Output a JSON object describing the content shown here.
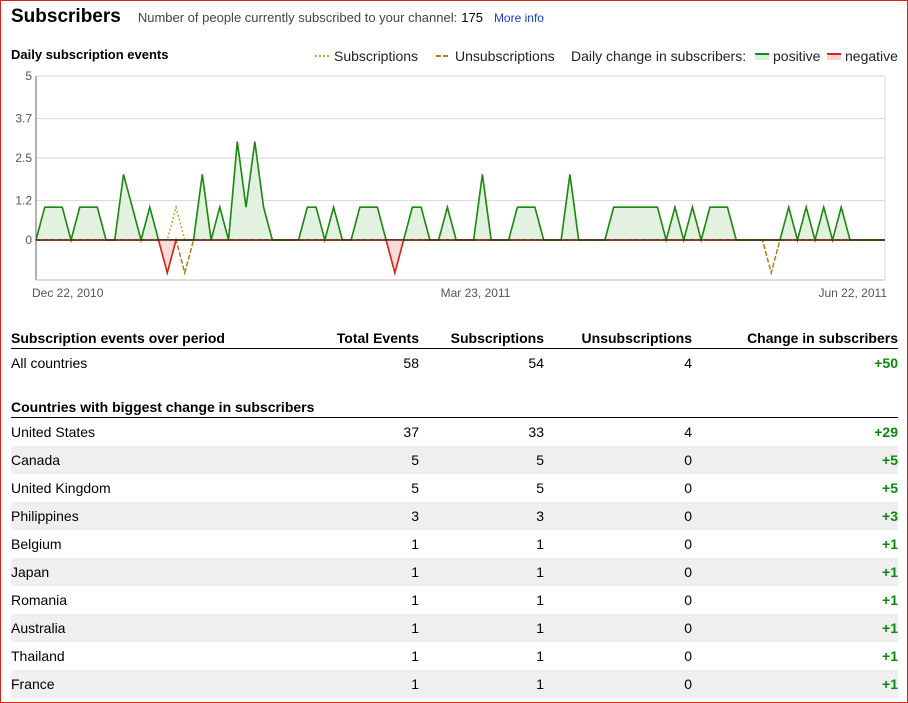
{
  "header": {
    "title": "Subscribers",
    "subtitle": "Number of people currently subscribed to your channel:",
    "count": "175",
    "more_info": "More info"
  },
  "chart_title": "Daily subscription events",
  "legend": {
    "subscriptions": "Subscriptions",
    "unsubscriptions": "Unsubscriptions",
    "daily_change": "Daily change in subscribers:",
    "positive": "positive",
    "negative": "negative"
  },
  "colors": {
    "positive": "#1a8a12",
    "negative": "#d4241a",
    "subscriptions": "#c9a43a",
    "unsubscriptions": "#b07d10",
    "frame": "#d9231b"
  },
  "chart_data": {
    "type": "line",
    "y_ticks": [
      "5",
      "3.7",
      "2.5",
      "1.2",
      "0"
    ],
    "ylim": [
      -1,
      5
    ],
    "x_ticks": [
      "Dec 22, 2010",
      "Mar 23, 2011",
      "Jun 22, 2011"
    ],
    "grid": true,
    "series": [
      {
        "name": "positive",
        "values": [
          0,
          1,
          1,
          1,
          0,
          1,
          1,
          1,
          0,
          0,
          2,
          1,
          0,
          1,
          0,
          -1,
          0,
          0,
          0,
          2,
          0,
          1,
          0,
          3,
          1,
          3,
          1,
          0,
          0,
          0,
          0,
          1,
          1,
          0,
          1,
          0,
          0,
          1,
          1,
          1,
          0,
          -1,
          0,
          1,
          1,
          0,
          0,
          1,
          0,
          0,
          0,
          2,
          0,
          0,
          0,
          1,
          1,
          1,
          0,
          0,
          0,
          2,
          0,
          0,
          0,
          0,
          1,
          1,
          1,
          1,
          1,
          1,
          0,
          1,
          0,
          1,
          0,
          1,
          1,
          1,
          0,
          0,
          0,
          0,
          0,
          0,
          1,
          0,
          1,
          0,
          1,
          0,
          1,
          0,
          0,
          0,
          0,
          0
        ]
      },
      {
        "name": "Subscriptions",
        "values": [
          0,
          1,
          1,
          1,
          0,
          1,
          1,
          1,
          0,
          0,
          2,
          1,
          0,
          1,
          0,
          0,
          1,
          0,
          0,
          2,
          0,
          1,
          0,
          3,
          1,
          3,
          1,
          0,
          0,
          0,
          0,
          1,
          1,
          0,
          1,
          0,
          0,
          1,
          1,
          1,
          0,
          0,
          0,
          1,
          1,
          0,
          0,
          1,
          0,
          0,
          0,
          2,
          0,
          0,
          0,
          1,
          1,
          1,
          0,
          0,
          0,
          2,
          0,
          0,
          0,
          0,
          1,
          1,
          1,
          1,
          1,
          1,
          0,
          1,
          0,
          1,
          0,
          1,
          1,
          1,
          0,
          0,
          0,
          0,
          0,
          0,
          1,
          0,
          1,
          0,
          1,
          0,
          1,
          0,
          0,
          0,
          0,
          0
        ]
      },
      {
        "name": "Unsubscriptions",
        "values": [
          0,
          0,
          0,
          0,
          0,
          0,
          0,
          0,
          0,
          0,
          0,
          0,
          0,
          0,
          0,
          -1,
          0,
          -1,
          0,
          0,
          0,
          0,
          0,
          0,
          0,
          0,
          0,
          0,
          0,
          0,
          0,
          0,
          0,
          0,
          0,
          0,
          0,
          0,
          0,
          0,
          0,
          -1,
          0,
          0,
          0,
          0,
          0,
          0,
          0,
          0,
          0,
          0,
          0,
          0,
          0,
          0,
          0,
          0,
          0,
          0,
          0,
          0,
          0,
          0,
          0,
          0,
          0,
          0,
          0,
          0,
          0,
          0,
          0,
          0,
          0,
          0,
          0,
          0,
          0,
          0,
          0,
          0,
          0,
          0,
          -1,
          0,
          0,
          0,
          0,
          0,
          0,
          0,
          0,
          0,
          0,
          0,
          0,
          0
        ]
      }
    ]
  },
  "summary": {
    "headers": [
      "Subscription events over period",
      "Total Events",
      "Subscriptions",
      "Unsubscriptions",
      "Change in subscribers"
    ],
    "row": [
      "All countries",
      "58",
      "54",
      "4",
      "+50"
    ]
  },
  "countries": {
    "title": "Countries with biggest change in subscribers",
    "rows": [
      [
        "United States",
        "37",
        "33",
        "4",
        "+29"
      ],
      [
        "Canada",
        "5",
        "5",
        "0",
        "+5"
      ],
      [
        "United Kingdom",
        "5",
        "5",
        "0",
        "+5"
      ],
      [
        "Philippines",
        "3",
        "3",
        "0",
        "+3"
      ],
      [
        "Belgium",
        "1",
        "1",
        "0",
        "+1"
      ],
      [
        "Japan",
        "1",
        "1",
        "0",
        "+1"
      ],
      [
        "Romania",
        "1",
        "1",
        "0",
        "+1"
      ],
      [
        "Australia",
        "1",
        "1",
        "0",
        "+1"
      ],
      [
        "Thailand",
        "1",
        "1",
        "0",
        "+1"
      ],
      [
        "France",
        "1",
        "1",
        "0",
        "+1"
      ]
    ]
  }
}
